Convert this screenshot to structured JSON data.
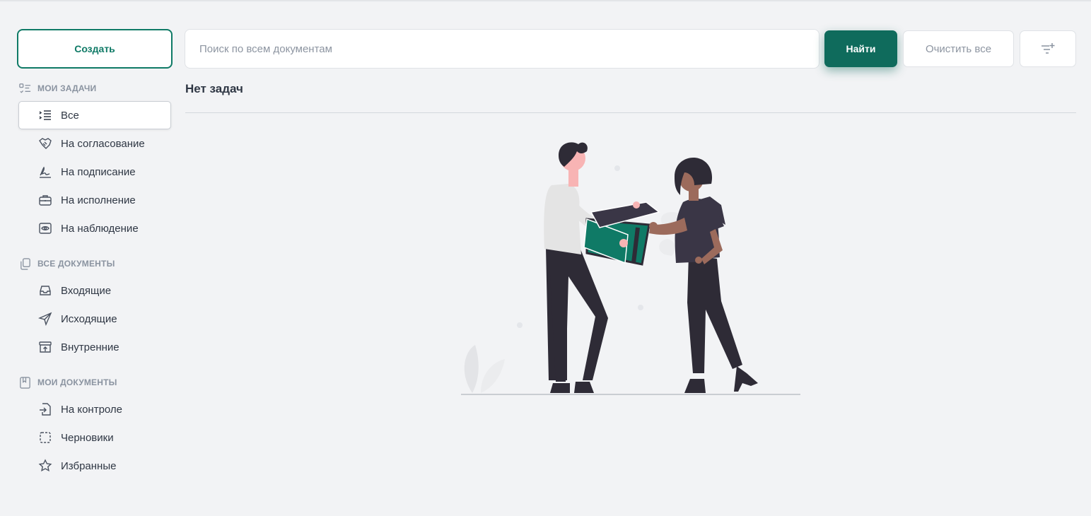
{
  "sidebar": {
    "create_label": "Создать",
    "sections": [
      {
        "title": "МОИ ЗАДАЧИ",
        "icon": "task-list-icon",
        "items": [
          {
            "label": "Все",
            "icon": "list-icon",
            "active": true
          },
          {
            "label": "На согласование",
            "icon": "handshake-icon"
          },
          {
            "label": "На подписание",
            "icon": "signature-icon"
          },
          {
            "label": "На исполнение",
            "icon": "briefcase-icon"
          },
          {
            "label": "На наблюдение",
            "icon": "eye-icon"
          }
        ]
      },
      {
        "title": "ВСЕ ДОКУМЕНТЫ",
        "icon": "documents-copy-icon",
        "items": [
          {
            "label": "Входящие",
            "icon": "inbox-icon"
          },
          {
            "label": "Исходящие",
            "icon": "send-icon"
          },
          {
            "label": "Внутренние",
            "icon": "archive-up-icon"
          }
        ]
      },
      {
        "title": "МОИ ДОКУМЕНТЫ",
        "icon": "bookmark-book-icon",
        "items": [
          {
            "label": "На контроле",
            "icon": "file-import-icon"
          },
          {
            "label": "Черновики",
            "icon": "dashed-square-icon"
          },
          {
            "label": "Избранные",
            "icon": "star-icon"
          }
        ]
      }
    ]
  },
  "search": {
    "placeholder": "Поиск по всем документам",
    "value": "",
    "find_label": "Найти",
    "clear_label": "Очистить все",
    "filter_icon": "filter-add-icon"
  },
  "main": {
    "title": "Нет задач",
    "empty_illustration": "two-people-handing-box-illustration"
  },
  "colors": {
    "accent": "#0f6b5c",
    "accent_border": "#0f7a66",
    "background": "#f2f3f5",
    "text": "#2f3744",
    "muted": "#8d95a1"
  }
}
